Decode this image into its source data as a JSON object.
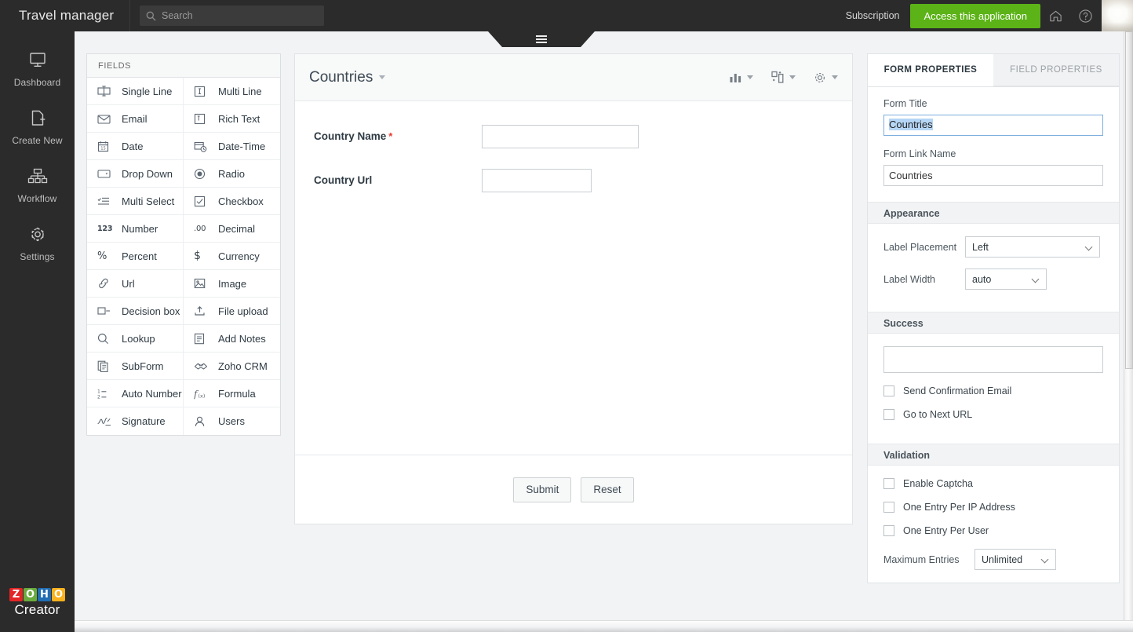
{
  "header": {
    "app_title": "Travel manager",
    "search": {
      "placeholder": "Search",
      "value": "",
      "icon": "search-icon"
    },
    "subscription_label": "Subscription",
    "access_button_label": "Access this application",
    "access_button_color": "#5cb317",
    "home_icon": "home-icon",
    "help_icon": "help-circle-icon",
    "avatar": "user-avatar"
  },
  "rail": {
    "items": [
      {
        "label": "Dashboard",
        "icon": "monitor-icon"
      },
      {
        "label": "Create New",
        "icon": "new-page-plus-icon"
      },
      {
        "label": "Workflow",
        "icon": "workflow-hierarchy-icon"
      },
      {
        "label": "Settings",
        "icon": "gear-icon"
      }
    ],
    "logo": {
      "word": "ZOHO",
      "letters": [
        "Z",
        "O",
        "H",
        "O"
      ],
      "product": "Creator"
    }
  },
  "fields_panel": {
    "title": "FIELDS",
    "items": [
      {
        "label": "Single Line",
        "icon": "single-line-icon"
      },
      {
        "label": "Multi Line",
        "icon": "multi-line-icon"
      },
      {
        "label": "Email",
        "icon": "envelope-icon"
      },
      {
        "label": "Rich Text",
        "icon": "rich-text-icon"
      },
      {
        "label": "Date",
        "icon": "calendar-icon"
      },
      {
        "label": "Date-Time",
        "icon": "calendar-clock-icon"
      },
      {
        "label": "Drop Down",
        "icon": "dropdown-icon"
      },
      {
        "label": "Radio",
        "icon": "radio-button-icon"
      },
      {
        "label": "Multi Select",
        "icon": "multi-select-list-icon"
      },
      {
        "label": "Checkbox",
        "icon": "checkbox-icon"
      },
      {
        "label": "Number",
        "icon": "number-123-icon"
      },
      {
        "label": "Decimal",
        "icon": "decimal-point-icon"
      },
      {
        "label": "Percent",
        "icon": "percent-icon"
      },
      {
        "label": "Currency",
        "icon": "dollar-icon"
      },
      {
        "label": "Url",
        "icon": "link-icon"
      },
      {
        "label": "Image",
        "icon": "image-icon"
      },
      {
        "label": "Decision box",
        "icon": "decision-box-icon"
      },
      {
        "label": "File upload",
        "icon": "upload-icon"
      },
      {
        "label": "Lookup",
        "icon": "magnifier-icon"
      },
      {
        "label": "Add Notes",
        "icon": "notes-icon"
      },
      {
        "label": "SubForm",
        "icon": "subform-icon"
      },
      {
        "label": "Zoho CRM",
        "icon": "handshake-icon"
      },
      {
        "label": "Auto Number",
        "icon": "auto-number-icon"
      },
      {
        "label": "Formula",
        "icon": "formula-fx-icon"
      },
      {
        "label": "Signature",
        "icon": "signature-icon"
      },
      {
        "label": "Users",
        "icon": "user-icon"
      }
    ]
  },
  "form": {
    "name": "Countries",
    "tools": [
      {
        "icon": "bar-chart-icon",
        "name": "chart-tool"
      },
      {
        "icon": "layout-add-icon",
        "name": "layout-tool"
      },
      {
        "icon": "gear-icon",
        "name": "settings-tool"
      }
    ],
    "fields": [
      {
        "label": "Country Name",
        "required": true,
        "value": "",
        "width": "w200"
      },
      {
        "label": "Country Url",
        "required": false,
        "value": "",
        "width": "w140"
      }
    ],
    "submit_label": "Submit",
    "reset_label": "Reset"
  },
  "properties": {
    "tabs": [
      {
        "label": "FORM PROPERTIES",
        "active": true
      },
      {
        "label": "FIELD PROPERTIES",
        "active": false
      }
    ],
    "form_title_label": "Form Title",
    "form_title_value": "Countries",
    "form_title_selected": true,
    "form_link_name_label": "Form Link Name",
    "form_link_name_value": "Countries",
    "appearance": {
      "heading": "Appearance",
      "label_placement_label": "Label Placement",
      "label_placement_value": "Left",
      "label_width_label": "Label Width",
      "label_width_value": "auto"
    },
    "success": {
      "heading": "Success",
      "message_value": "",
      "checkboxes": [
        {
          "label": "Send Confirmation Email",
          "checked": false
        },
        {
          "label": "Go to Next URL",
          "checked": false
        }
      ]
    },
    "validation": {
      "heading": "Validation",
      "checkboxes": [
        {
          "label": "Enable Captcha",
          "checked": false
        },
        {
          "label": "One Entry Per IP Address",
          "checked": false
        },
        {
          "label": "One Entry Per User",
          "checked": false
        }
      ],
      "max_entries_label": "Maximum Entries",
      "max_entries_value": "Unlimited"
    }
  }
}
